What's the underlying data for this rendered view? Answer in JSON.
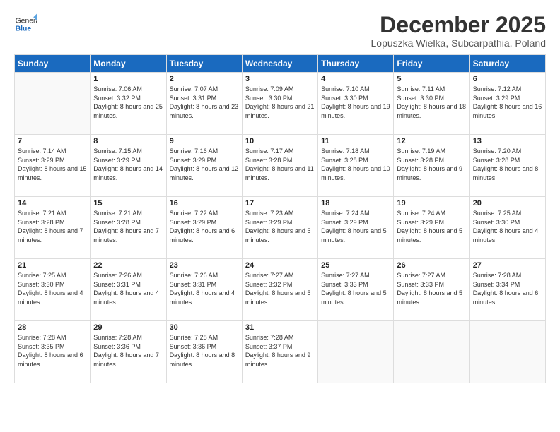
{
  "header": {
    "logo": {
      "general": "General",
      "blue": "Blue"
    },
    "month": "December 2025",
    "location": "Lopuszka Wielka, Subcarpathia, Poland"
  },
  "weekdays": [
    "Sunday",
    "Monday",
    "Tuesday",
    "Wednesday",
    "Thursday",
    "Friday",
    "Saturday"
  ],
  "weeks": [
    [
      {
        "day": "",
        "empty": true
      },
      {
        "day": "1",
        "sunrise": "7:06 AM",
        "sunset": "3:32 PM",
        "daylight": "8 hours and 25 minutes."
      },
      {
        "day": "2",
        "sunrise": "7:07 AM",
        "sunset": "3:31 PM",
        "daylight": "8 hours and 23 minutes."
      },
      {
        "day": "3",
        "sunrise": "7:09 AM",
        "sunset": "3:30 PM",
        "daylight": "8 hours and 21 minutes."
      },
      {
        "day": "4",
        "sunrise": "7:10 AM",
        "sunset": "3:30 PM",
        "daylight": "8 hours and 19 minutes."
      },
      {
        "day": "5",
        "sunrise": "7:11 AM",
        "sunset": "3:30 PM",
        "daylight": "8 hours and 18 minutes."
      },
      {
        "day": "6",
        "sunrise": "7:12 AM",
        "sunset": "3:29 PM",
        "daylight": "8 hours and 16 minutes."
      }
    ],
    [
      {
        "day": "7",
        "sunrise": "7:14 AM",
        "sunset": "3:29 PM",
        "daylight": "8 hours and 15 minutes."
      },
      {
        "day": "8",
        "sunrise": "7:15 AM",
        "sunset": "3:29 PM",
        "daylight": "8 hours and 14 minutes."
      },
      {
        "day": "9",
        "sunrise": "7:16 AM",
        "sunset": "3:29 PM",
        "daylight": "8 hours and 12 minutes."
      },
      {
        "day": "10",
        "sunrise": "7:17 AM",
        "sunset": "3:28 PM",
        "daylight": "8 hours and 11 minutes."
      },
      {
        "day": "11",
        "sunrise": "7:18 AM",
        "sunset": "3:28 PM",
        "daylight": "8 hours and 10 minutes."
      },
      {
        "day": "12",
        "sunrise": "7:19 AM",
        "sunset": "3:28 PM",
        "daylight": "8 hours and 9 minutes."
      },
      {
        "day": "13",
        "sunrise": "7:20 AM",
        "sunset": "3:28 PM",
        "daylight": "8 hours and 8 minutes."
      }
    ],
    [
      {
        "day": "14",
        "sunrise": "7:21 AM",
        "sunset": "3:28 PM",
        "daylight": "8 hours and 7 minutes."
      },
      {
        "day": "15",
        "sunrise": "7:21 AM",
        "sunset": "3:28 PM",
        "daylight": "8 hours and 7 minutes."
      },
      {
        "day": "16",
        "sunrise": "7:22 AM",
        "sunset": "3:29 PM",
        "daylight": "8 hours and 6 minutes."
      },
      {
        "day": "17",
        "sunrise": "7:23 AM",
        "sunset": "3:29 PM",
        "daylight": "8 hours and 5 minutes."
      },
      {
        "day": "18",
        "sunrise": "7:24 AM",
        "sunset": "3:29 PM",
        "daylight": "8 hours and 5 minutes."
      },
      {
        "day": "19",
        "sunrise": "7:24 AM",
        "sunset": "3:29 PM",
        "daylight": "8 hours and 5 minutes."
      },
      {
        "day": "20",
        "sunrise": "7:25 AM",
        "sunset": "3:30 PM",
        "daylight": "8 hours and 4 minutes."
      }
    ],
    [
      {
        "day": "21",
        "sunrise": "7:25 AM",
        "sunset": "3:30 PM",
        "daylight": "8 hours and 4 minutes."
      },
      {
        "day": "22",
        "sunrise": "7:26 AM",
        "sunset": "3:31 PM",
        "daylight": "8 hours and 4 minutes."
      },
      {
        "day": "23",
        "sunrise": "7:26 AM",
        "sunset": "3:31 PM",
        "daylight": "8 hours and 4 minutes."
      },
      {
        "day": "24",
        "sunrise": "7:27 AM",
        "sunset": "3:32 PM",
        "daylight": "8 hours and 5 minutes."
      },
      {
        "day": "25",
        "sunrise": "7:27 AM",
        "sunset": "3:33 PM",
        "daylight": "8 hours and 5 minutes."
      },
      {
        "day": "26",
        "sunrise": "7:27 AM",
        "sunset": "3:33 PM",
        "daylight": "8 hours and 5 minutes."
      },
      {
        "day": "27",
        "sunrise": "7:28 AM",
        "sunset": "3:34 PM",
        "daylight": "8 hours and 6 minutes."
      }
    ],
    [
      {
        "day": "28",
        "sunrise": "7:28 AM",
        "sunset": "3:35 PM",
        "daylight": "8 hours and 6 minutes."
      },
      {
        "day": "29",
        "sunrise": "7:28 AM",
        "sunset": "3:36 PM",
        "daylight": "8 hours and 7 minutes."
      },
      {
        "day": "30",
        "sunrise": "7:28 AM",
        "sunset": "3:36 PM",
        "daylight": "8 hours and 8 minutes."
      },
      {
        "day": "31",
        "sunrise": "7:28 AM",
        "sunset": "3:37 PM",
        "daylight": "8 hours and 9 minutes."
      },
      {
        "day": "",
        "empty": true
      },
      {
        "day": "",
        "empty": true
      },
      {
        "day": "",
        "empty": true
      }
    ]
  ],
  "labels": {
    "sunrise": "Sunrise:",
    "sunset": "Sunset:",
    "daylight": "Daylight:"
  }
}
